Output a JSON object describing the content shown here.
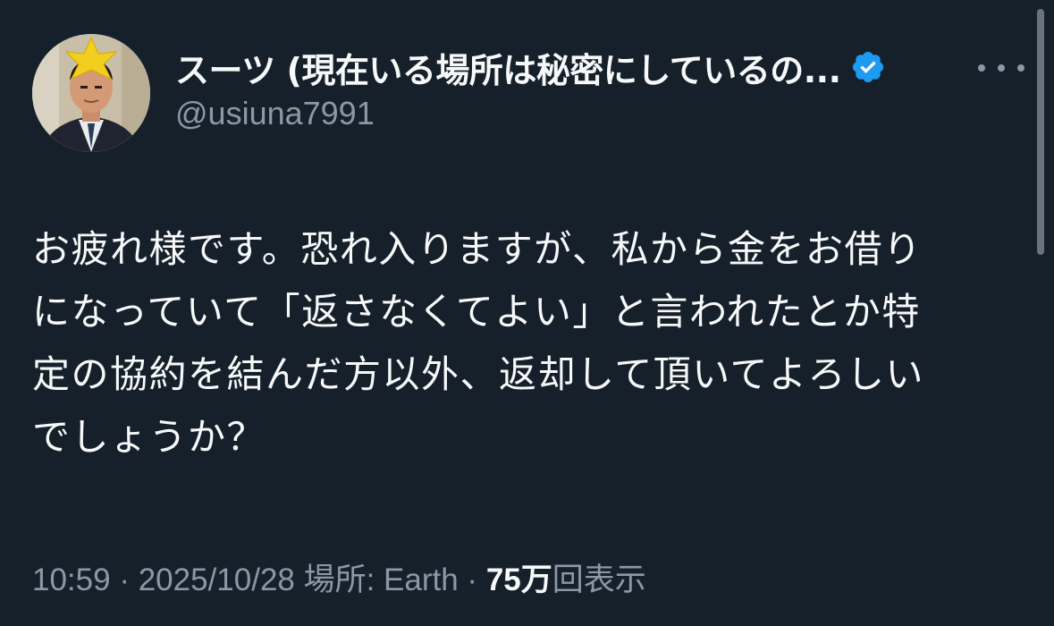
{
  "author": {
    "display_name": "スーツ (現在いる場所は秘密にしているの...",
    "handle": "@usiuna7991",
    "verified_icon": "verified-badge-icon",
    "verified_color": "#1d9bf0"
  },
  "tweet": {
    "text_lines": [
      "お疲れ様です。恐れ入りますが、私から金をお借り",
      "になっていて「返さなくてよい」と言われたとか特",
      "定の協約を結んだ方以外、返却して頂いてよろしい",
      "でしょうか？"
    ]
  },
  "meta": {
    "time": "10:59",
    "sep1": " · ",
    "date": "2025/10/28",
    "location": " 場所: Earth",
    "sep2": " · ",
    "views_count": "75万",
    "views_label": "回表示"
  },
  "colors": {
    "background": "#15202b",
    "text_primary": "#f7f9f9",
    "text_secondary": "#8b98a5"
  }
}
